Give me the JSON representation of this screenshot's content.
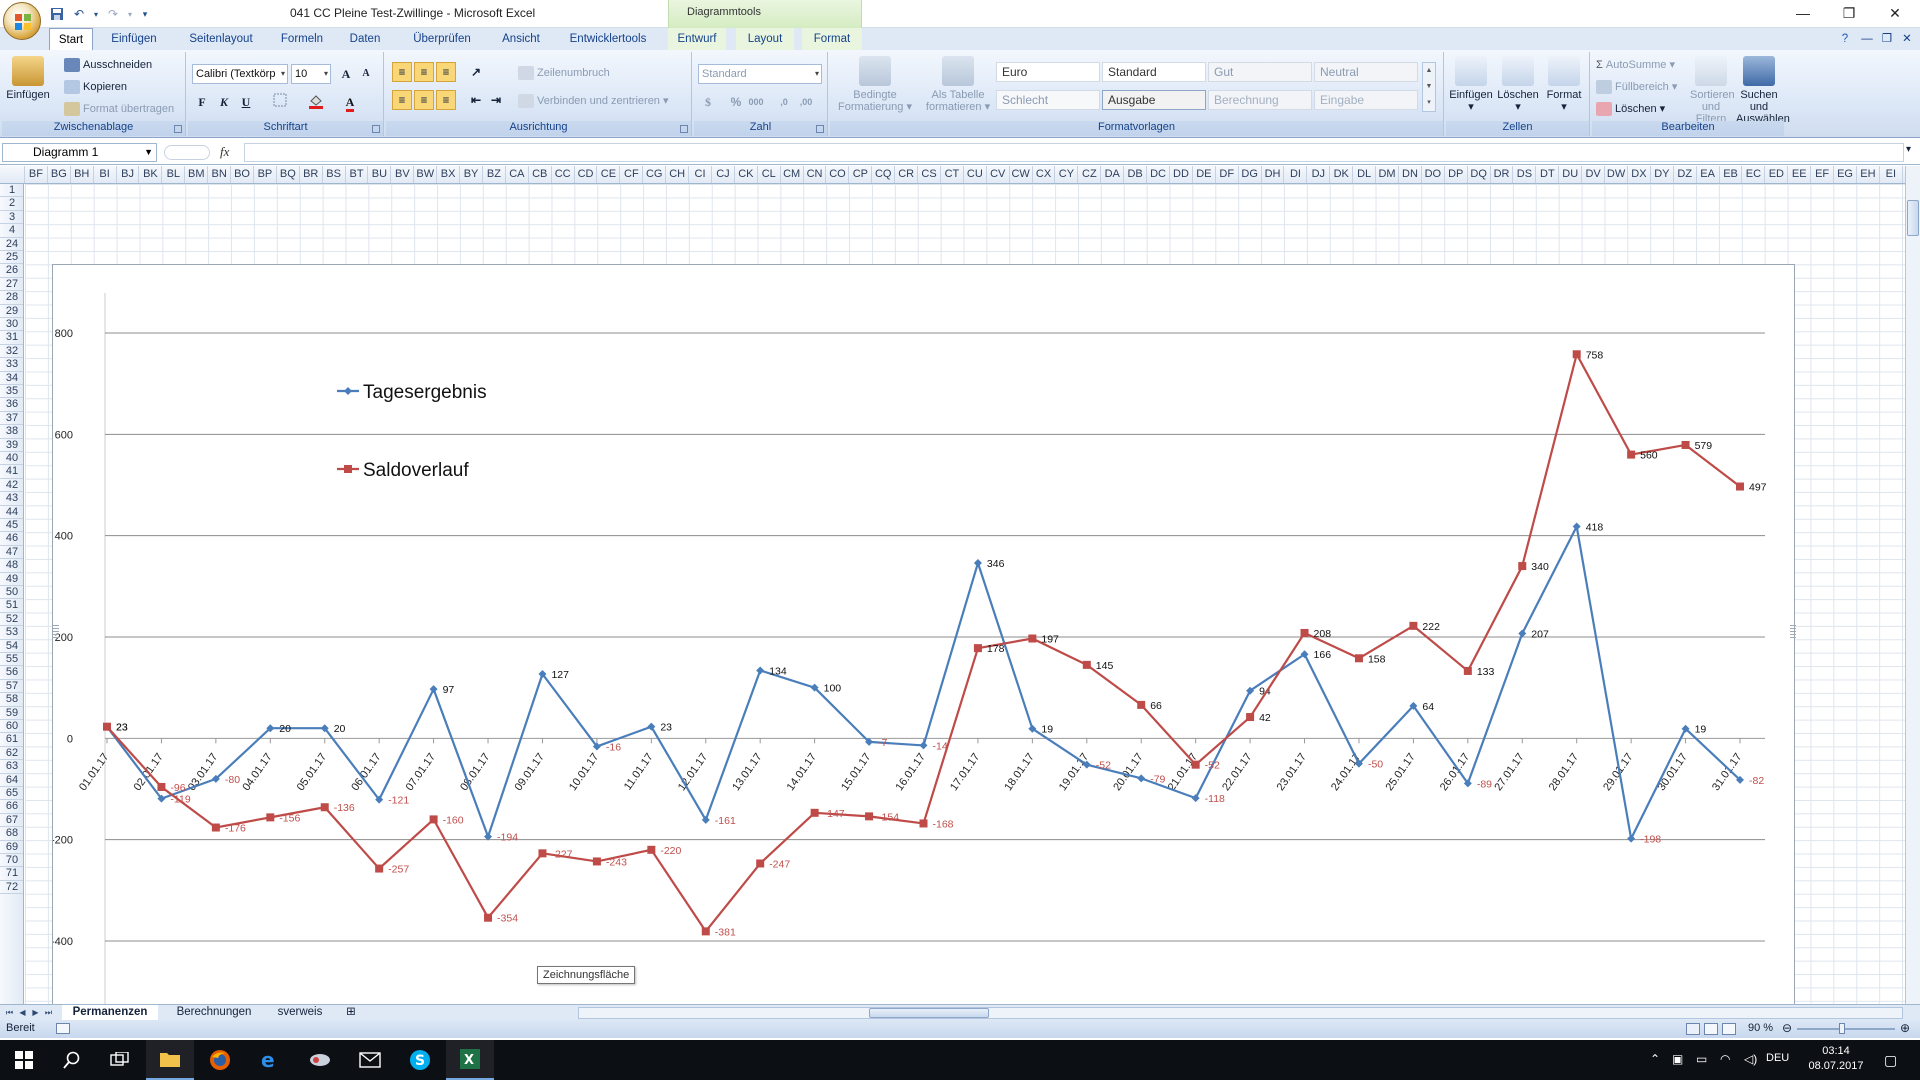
{
  "window": {
    "title": "041 CC Pleine Test-Zwillinge - Microsoft Excel",
    "context_tab": "Diagrammtools"
  },
  "ribbon_tabs": [
    "Start",
    "Einfügen",
    "Seitenlayout",
    "Formeln",
    "Daten",
    "Überprüfen",
    "Ansicht",
    "Entwicklertools",
    "Entwurf",
    "Layout",
    "Format"
  ],
  "active_tab": "Start",
  "ribbon": {
    "clipboard": {
      "paste": "Einfügen",
      "cut": "Ausschneiden",
      "copy": "Kopieren",
      "format_painter": "Format übertragen",
      "label": "Zwischenablage"
    },
    "font": {
      "name": "Calibri (Textkörp",
      "size": "10",
      "bold": "F",
      "italic": "K",
      "underline": "U",
      "label": "Schriftart"
    },
    "alignment": {
      "wrap": "Zeilenumbruch",
      "merge": "Verbinden und zentrieren",
      "label": "Ausrichtung"
    },
    "number": {
      "format": "Standard",
      "label": "Zahl"
    },
    "styles": {
      "conditional": "Bedingte Formatierung",
      "as_table": "Als Tabelle formatieren",
      "cells": [
        "Euro",
        "Standard",
        "Gut",
        "Neutral",
        "Schlecht",
        "Ausgabe",
        "Berechnung",
        "Eingabe"
      ],
      "label": "Formatvorlagen"
    },
    "cells_group": {
      "insert": "Einfügen",
      "delete": "Löschen",
      "format": "Format",
      "label": "Zellen"
    },
    "editing": {
      "autosum": "AutoSumme",
      "fill": "Füllbereich",
      "clear": "Löschen",
      "sort": "Sortieren und Filtern",
      "find": "Suchen und Auswählen",
      "label": "Bearbeiten"
    }
  },
  "formula_bar": {
    "name_box": "Diagramm 1",
    "fx": "fx",
    "value": ""
  },
  "column_headers": [
    "BF",
    "BG",
    "BH",
    "BI",
    "BJ",
    "BK",
    "BL",
    "BM",
    "BN",
    "BO",
    "BP",
    "BQ",
    "BR",
    "BS",
    "BT",
    "BU",
    "BV",
    "BW",
    "BX",
    "BY",
    "BZ",
    "CA",
    "CB",
    "CC",
    "CD",
    "CE",
    "CF",
    "CG",
    "CH",
    "CI",
    "CJ",
    "CK",
    "CL",
    "CM",
    "CN",
    "CO",
    "CP",
    "CQ",
    "CR",
    "CS",
    "CT",
    "CU",
    "CV",
    "CW",
    "CX",
    "CY",
    "CZ",
    "DA",
    "DB",
    "DC",
    "DD",
    "DE",
    "DF",
    "DG",
    "DH",
    "DI",
    "DJ",
    "DK",
    "DL",
    "DM",
    "DN",
    "DO",
    "DP",
    "DQ",
    "DR",
    "DS",
    "DT",
    "DU",
    "DV",
    "DW",
    "DX",
    "DY",
    "DZ",
    "EA",
    "EB",
    "EC",
    "ED",
    "EE",
    "EF",
    "EG",
    "EH",
    "EI"
  ],
  "row_headers": [
    "1",
    "2",
    "3",
    "4",
    "24",
    "25",
    "26",
    "27",
    "28",
    "29",
    "30",
    "31",
    "32",
    "33",
    "34",
    "35",
    "36",
    "37",
    "38",
    "39",
    "40",
    "41",
    "42",
    "43",
    "44",
    "45",
    "46",
    "47",
    "48",
    "49",
    "50",
    "51",
    "52",
    "53",
    "54",
    "55",
    "56",
    "57",
    "58",
    "59",
    "60",
    "61",
    "62",
    "63",
    "64",
    "65",
    "66",
    "67",
    "68",
    "69",
    "70",
    "71",
    "72"
  ],
  "chart_data": {
    "type": "line",
    "categories": [
      "01.01.17",
      "02.01.17",
      "03.01.17",
      "04.01.17",
      "05.01.17",
      "06.01.17",
      "07.01.17",
      "08.01.17",
      "09.01.17",
      "10.01.17",
      "11.01.17",
      "12.01.17",
      "13.01.17",
      "14.01.17",
      "15.01.17",
      "16.01.17",
      "17.01.17",
      "18.01.17",
      "19.01.17",
      "20.01.17",
      "21.01.17",
      "22.01.17",
      "23.01.17",
      "24.01.17",
      "25.01.17",
      "26.01.17",
      "27.01.17",
      "28.01.17",
      "29.01.17",
      "30.01.17",
      "31.01.17"
    ],
    "series": [
      {
        "name": "Tagesergebnis",
        "color": "#4a7ebb",
        "marker": "diamond",
        "values": [
          23,
          -119,
          -80,
          20,
          20,
          -121,
          97,
          -194,
          127,
          -16,
          23,
          -161,
          134,
          100,
          -7,
          -14,
          346,
          19,
          -52,
          -79,
          -118,
          94,
          166,
          -50,
          64,
          -89,
          207,
          418,
          -198,
          19,
          -82
        ]
      },
      {
        "name": "Saldoverlauf",
        "color": "#be4b48",
        "marker": "square",
        "values": [
          23,
          -96,
          -176,
          -156,
          -136,
          -257,
          -160,
          -354,
          -227,
          -243,
          -220,
          -381,
          -247,
          -147,
          -154,
          -168,
          178,
          197,
          145,
          66,
          -52,
          42,
          208,
          158,
          222,
          133,
          340,
          758,
          560,
          579,
          497
        ]
      }
    ],
    "yticks": [
      -400,
      -200,
      0,
      200,
      400,
      600,
      800
    ],
    "ylim": [
      -400,
      800
    ],
    "legend_position": "top-left",
    "grid": true,
    "title": "",
    "xlabel": "",
    "ylabel": ""
  },
  "tooltip": "Zeichnungsfläche",
  "sheet_tabs": [
    "Permanenzen",
    "Berechnungen",
    "sverweis"
  ],
  "active_sheet": "Permanenzen",
  "status": {
    "ready": "Bereit",
    "zoom": "90 %"
  },
  "taskbar": {
    "lang": "DEU",
    "time": "03:14",
    "date": "08.07.2017"
  }
}
